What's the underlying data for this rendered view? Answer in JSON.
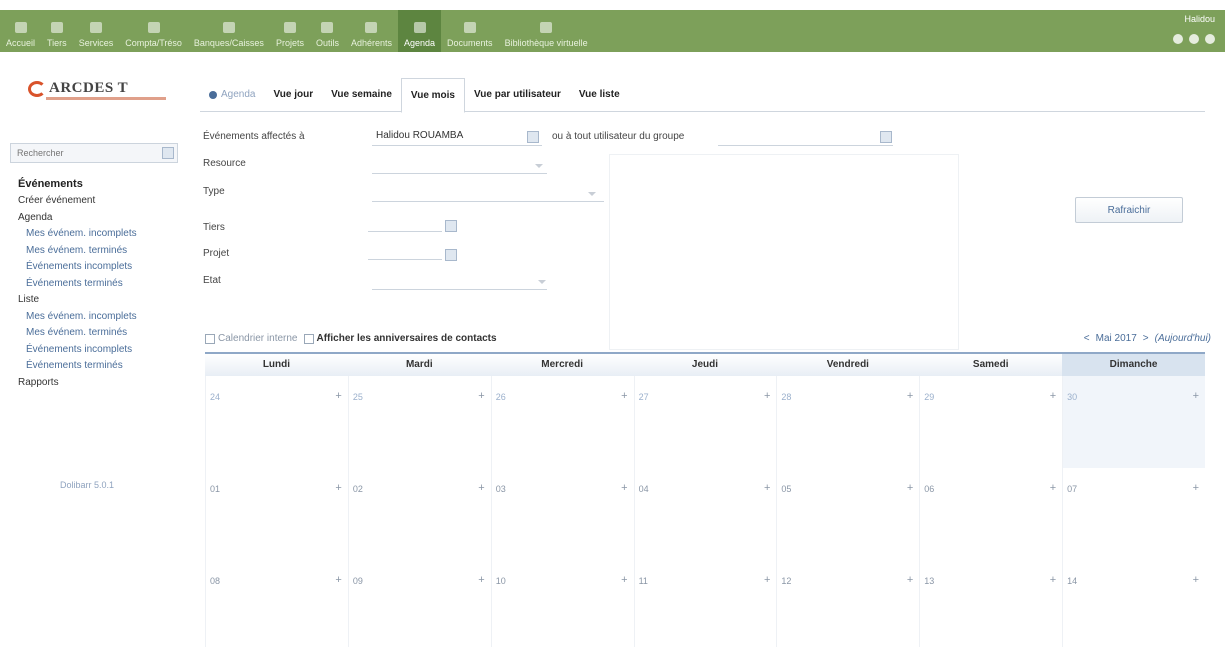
{
  "topnav": {
    "items": [
      {
        "label": "Accueil"
      },
      {
        "label": "Tiers"
      },
      {
        "label": "Services"
      },
      {
        "label": "Compta/Tréso"
      },
      {
        "label": "Banques/Caisses"
      },
      {
        "label": "Projets"
      },
      {
        "label": "Outils"
      },
      {
        "label": "Adhérents"
      },
      {
        "label": "Agenda"
      },
      {
        "label": "Documents"
      },
      {
        "label": "Bibliothèque virtuelle"
      }
    ],
    "active_index": 8,
    "user": "Halidou"
  },
  "logo": {
    "text": "ARCDES T"
  },
  "sidebar": {
    "search_placeholder": "Rechercher",
    "items": [
      {
        "label": "Événements",
        "level": "head"
      },
      {
        "label": "Créer événement",
        "level": "lvl1"
      },
      {
        "label": "Agenda",
        "level": "lvl1"
      },
      {
        "label": "Mes événem. incomplets",
        "level": "lvl2"
      },
      {
        "label": "Mes événem. terminés",
        "level": "lvl2"
      },
      {
        "label": "Événements incomplets",
        "level": "lvl2"
      },
      {
        "label": "Événements terminés",
        "level": "lvl2"
      },
      {
        "label": "Liste",
        "level": "lvl1"
      },
      {
        "label": "Mes événem. incomplets",
        "level": "lvl2"
      },
      {
        "label": "Mes événem. terminés",
        "level": "lvl2"
      },
      {
        "label": "Événements incomplets",
        "level": "lvl2"
      },
      {
        "label": "Événements terminés",
        "level": "lvl2"
      },
      {
        "label": "Rapports",
        "level": "lvl1"
      }
    ],
    "version": "Dolibarr 5.0.1"
  },
  "tabs": {
    "agenda": "Agenda",
    "items": [
      "Vue jour",
      "Vue semaine",
      "Vue mois",
      "Vue par utilisateur",
      "Vue liste"
    ],
    "active_index": 2
  },
  "filters": {
    "assigned_label": "Événements affectés à",
    "assigned_value": "Halidou ROUAMBA",
    "group_label": "ou à tout utilisateur du groupe",
    "resource_label": "Resource",
    "type_label": "Type",
    "thirdparty_label": "Tiers",
    "project_label": "Projet",
    "status_label": "Etat",
    "refresh_label": "Rafraichir"
  },
  "calendar": {
    "internal_label": "Calendrier interne",
    "birthdays_label": "Afficher les anniversaires de contacts",
    "month_label": "Mai 2017",
    "prev_label": "<",
    "next_label": ">",
    "today_label": "(Aujourd'hui)",
    "days": [
      "Lundi",
      "Mardi",
      "Mercredi",
      "Jeudi",
      "Vendredi",
      "Samedi",
      "Dimanche"
    ],
    "weeks": [
      [
        "24",
        "25",
        "26",
        "27",
        "28",
        "29",
        "30"
      ],
      [
        "01",
        "02",
        "03",
        "04",
        "05",
        "06",
        "07"
      ],
      [
        "08",
        "09",
        "10",
        "11",
        "12",
        "13",
        "14"
      ]
    ],
    "add_symbol": "+"
  }
}
